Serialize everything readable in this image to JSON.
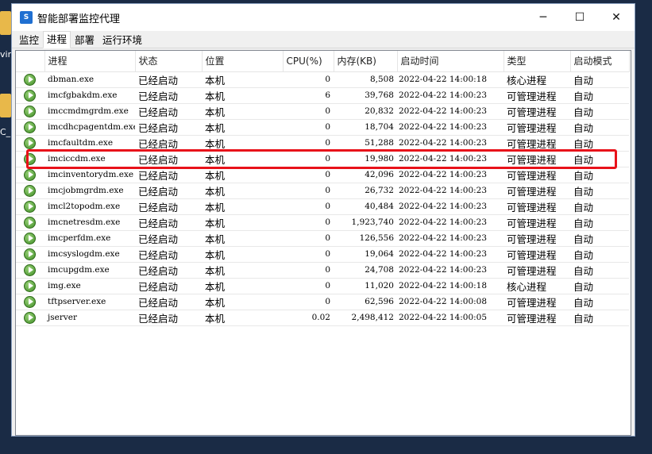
{
  "desktop": {
    "labels": [
      "vin",
      "C_i"
    ]
  },
  "window": {
    "title": "智能部署监控代理",
    "app_icon_text": "S",
    "buttons": {
      "minimize": "─",
      "maximize": "☐",
      "close": "✕"
    }
  },
  "tabs": [
    {
      "label": "监控",
      "active": false
    },
    {
      "label": "进程",
      "active": true
    },
    {
      "label": "部署",
      "active": false
    },
    {
      "label": "运行环境",
      "active": false
    }
  ],
  "table": {
    "headers": [
      "",
      "进程",
      "状态",
      "位置",
      "CPU(%)",
      "内存(KB)",
      "启动时间",
      "类型",
      "启动模式"
    ],
    "rows": [
      [
        "dbman.exe",
        "已经启动",
        "本机",
        "0",
        "8,508",
        "2022-04-22 14:00:18",
        "核心进程",
        "自动"
      ],
      [
        "imcfgbakdm.exe",
        "已经启动",
        "本机",
        "6",
        "39,768",
        "2022-04-22 14:00:23",
        "可管理进程",
        "自动"
      ],
      [
        "imccmdmgrdm.exe",
        "已经启动",
        "本机",
        "0",
        "20,832",
        "2022-04-22 14:00:23",
        "可管理进程",
        "自动"
      ],
      [
        "imcdhcpagentdm.exe",
        "已经启动",
        "本机",
        "0",
        "18,704",
        "2022-04-22 14:00:23",
        "可管理进程",
        "自动"
      ],
      [
        "imcfaultdm.exe",
        "已经启动",
        "本机",
        "0",
        "51,288",
        "2022-04-22 14:00:23",
        "可管理进程",
        "自动"
      ],
      [
        "imciccdm.exe",
        "已经启动",
        "本机",
        "0",
        "19,980",
        "2022-04-22 14:00:23",
        "可管理进程",
        "自动"
      ],
      [
        "imcinventorydm.exe",
        "已经启动",
        "本机",
        "0",
        "42,096",
        "2022-04-22 14:00:23",
        "可管理进程",
        "自动"
      ],
      [
        "imcjobmgrdm.exe",
        "已经启动",
        "本机",
        "0",
        "26,732",
        "2022-04-22 14:00:23",
        "可管理进程",
        "自动"
      ],
      [
        "imcl2topodm.exe",
        "已经启动",
        "本机",
        "0",
        "40,484",
        "2022-04-22 14:00:23",
        "可管理进程",
        "自动"
      ],
      [
        "imcnetresdm.exe",
        "已经启动",
        "本机",
        "0",
        "1,923,740",
        "2022-04-22 14:00:23",
        "可管理进程",
        "自动"
      ],
      [
        "imcperfdm.exe",
        "已经启动",
        "本机",
        "0",
        "126,556",
        "2022-04-22 14:00:23",
        "可管理进程",
        "自动"
      ],
      [
        "imcsyslogdm.exe",
        "已经启动",
        "本机",
        "0",
        "19,064",
        "2022-04-22 14:00:23",
        "可管理进程",
        "自动"
      ],
      [
        "imcupgdm.exe",
        "已经启动",
        "本机",
        "0",
        "24,708",
        "2022-04-22 14:00:23",
        "可管理进程",
        "自动"
      ],
      [
        "img.exe",
        "已经启动",
        "本机",
        "0",
        "11,020",
        "2022-04-22 14:00:18",
        "核心进程",
        "自动"
      ],
      [
        "tftpserver.exe",
        "已经启动",
        "本机",
        "0",
        "62,596",
        "2022-04-22 14:00:08",
        "可管理进程",
        "自动"
      ],
      [
        "jserver",
        "已经启动",
        "本机",
        "0.02",
        "2,498,412",
        "2022-04-22 14:00:05",
        "可管理进程",
        "自动"
      ]
    ],
    "highlighted_row": 5,
    "highlight_color": "#e8121a"
  }
}
